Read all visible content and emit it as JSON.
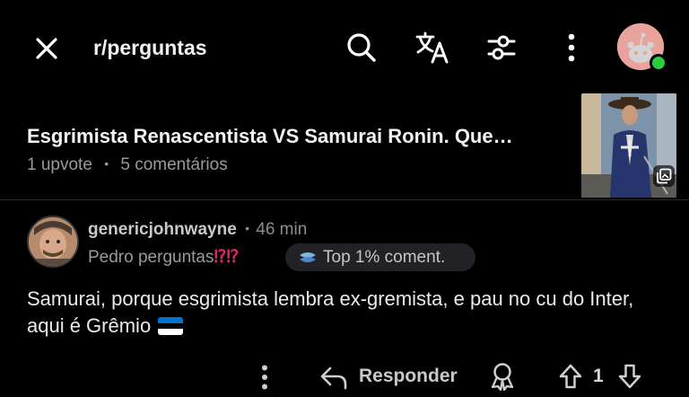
{
  "header": {
    "subreddit": "r/perguntas",
    "icons": [
      "close-icon",
      "search-icon",
      "translate-icon",
      "sort-filter-icon",
      "more-vertical-icon"
    ],
    "user_avatar": "snoo-avatar",
    "online_status": "online"
  },
  "post": {
    "title": "Esgrimista Renascentista VS Samurai Ronin. Que…",
    "upvotes": "1 upvote",
    "separator": "•",
    "comments": "5 comentários",
    "thumbnail": "musketeer-image",
    "gallery_icon": "gallery-icon"
  },
  "comment": {
    "author": "genericjohnwayne",
    "separator": "•",
    "time": "46 min",
    "flair_text": "Pedro perguntas",
    "flair_emoji": "⁉⁉",
    "badge_label": "Top 1% coment.",
    "body": "Samurai, porque esgrimista lembra ex-gremista, e pau no cu do Inter, aqui é Grêmio",
    "flag_colors": [
      "#0072ce",
      "#000000",
      "#ffffff"
    ]
  },
  "actions": {
    "reply_label": "Responder",
    "vote_count": "1",
    "icons": [
      "more-vertical-icon",
      "reply-icon",
      "award-icon",
      "upvote-icon",
      "downvote-icon"
    ]
  },
  "colors": {
    "background": "#000000",
    "muted_text": "#9a9a9a",
    "online": "#2ecc40",
    "flair_emoji": "#e0245e"
  }
}
